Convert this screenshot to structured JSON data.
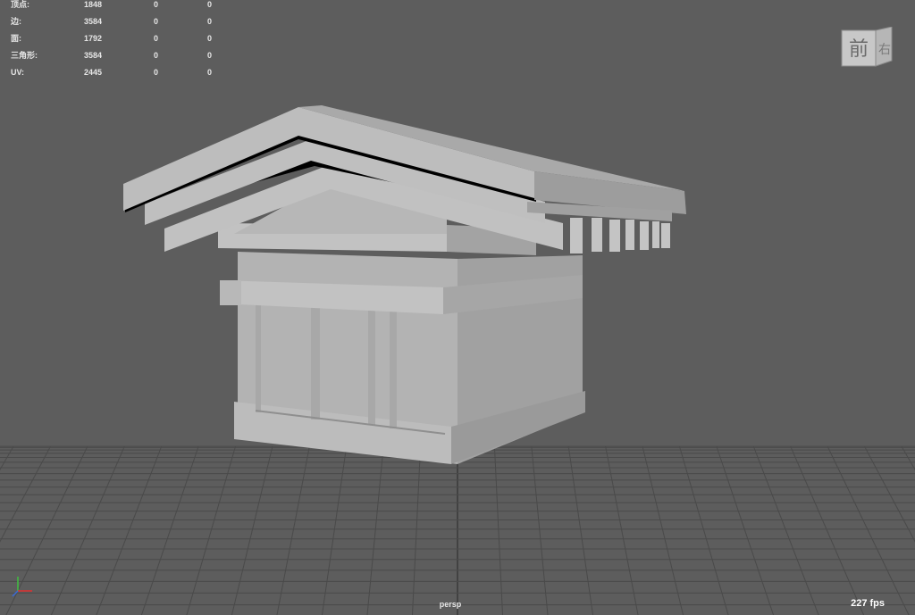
{
  "stats": {
    "rows": [
      {
        "label": "顶点:",
        "values": [
          "1848",
          "0",
          "0"
        ]
      },
      {
        "label": "边:",
        "values": [
          "3584",
          "0",
          "0"
        ]
      },
      {
        "label": "面:",
        "values": [
          "1792",
          "0",
          "0"
        ]
      },
      {
        "label": "三角形:",
        "values": [
          "3584",
          "0",
          "0"
        ]
      },
      {
        "label": "UV:",
        "values": [
          "2445",
          "0",
          "0"
        ]
      }
    ]
  },
  "viewcube": {
    "front_face": "前",
    "right_face": "右"
  },
  "camera": "persp",
  "fps": "227 fps",
  "colors": {
    "background": "#5d5d5d",
    "grid_line": "#4a4a4a",
    "grid_axis": "#3a3a3a",
    "mesh_light": "#b4b4b4",
    "mesh_mid": "#a4a4a4",
    "mesh_dark": "#8e8e8e",
    "mesh_shadow": "#000000",
    "axis_x": "#e03030",
    "axis_y": "#40c040",
    "axis_z": "#3a6ad8"
  },
  "icons": {
    "viewcube": "viewcube-icon",
    "axis": "axis-gizmo-icon"
  }
}
